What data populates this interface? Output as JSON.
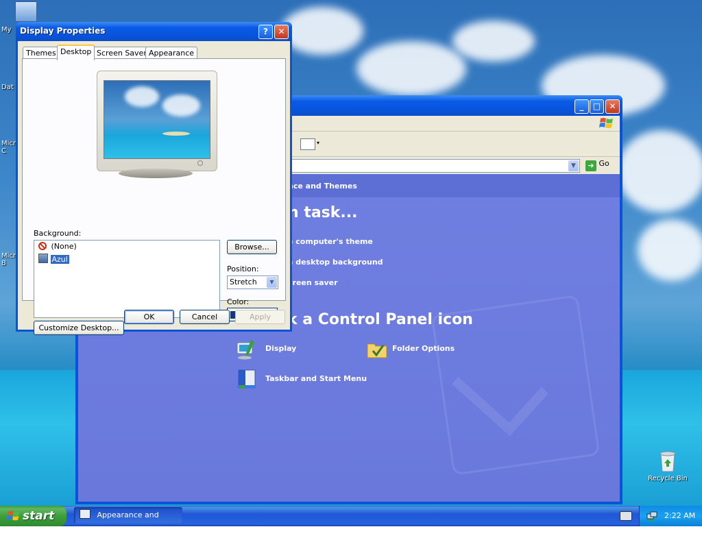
{
  "desktop": {
    "icons": [
      {
        "label": "My",
        "name": "my-computer-icon"
      },
      {
        "label": "Dat",
        "name": "data-icon"
      },
      {
        "label": "Micr\nC",
        "name": "microsoft-icon-1"
      },
      {
        "label": "Micr\nB",
        "name": "microsoft-icon-2"
      }
    ],
    "recycle_bin_label": "Recycle Bin"
  },
  "control_panel": {
    "header_text": "nce and Themes",
    "pick_task": "n task...",
    "tasks": [
      "e computer's theme",
      "e desktop background",
      "creen saver"
    ],
    "pick_icon": "or pick a Control Panel icon",
    "icons": [
      {
        "label": "Display",
        "icon": "display-icon"
      },
      {
        "label": "Folder Options",
        "icon": "folder-options-icon"
      },
      {
        "label": "Taskbar and Start Menu",
        "icon": "taskbar-start-menu-icon"
      }
    ],
    "go_label": "Go"
  },
  "dialog": {
    "title": "Display Properties",
    "tabs": [
      "Themes",
      "Desktop",
      "Screen Saver",
      "Appearance"
    ],
    "active_tab": "Desktop",
    "background_label": "Background:",
    "background_items": [
      "(None)",
      "Azul"
    ],
    "selected_background": "Azul",
    "browse_label": "Browse...",
    "position_label": "Position:",
    "position_value": "Stretch",
    "color_label": "Color:",
    "color_value": "#0a3a8f",
    "customize_label": "Customize Desktop...",
    "ok_label": "OK",
    "cancel_label": "Cancel",
    "apply_label": "Apply"
  },
  "taskbar": {
    "start_label": "start",
    "task_button": "Appearance and The...",
    "clock": "2:22 AM"
  }
}
